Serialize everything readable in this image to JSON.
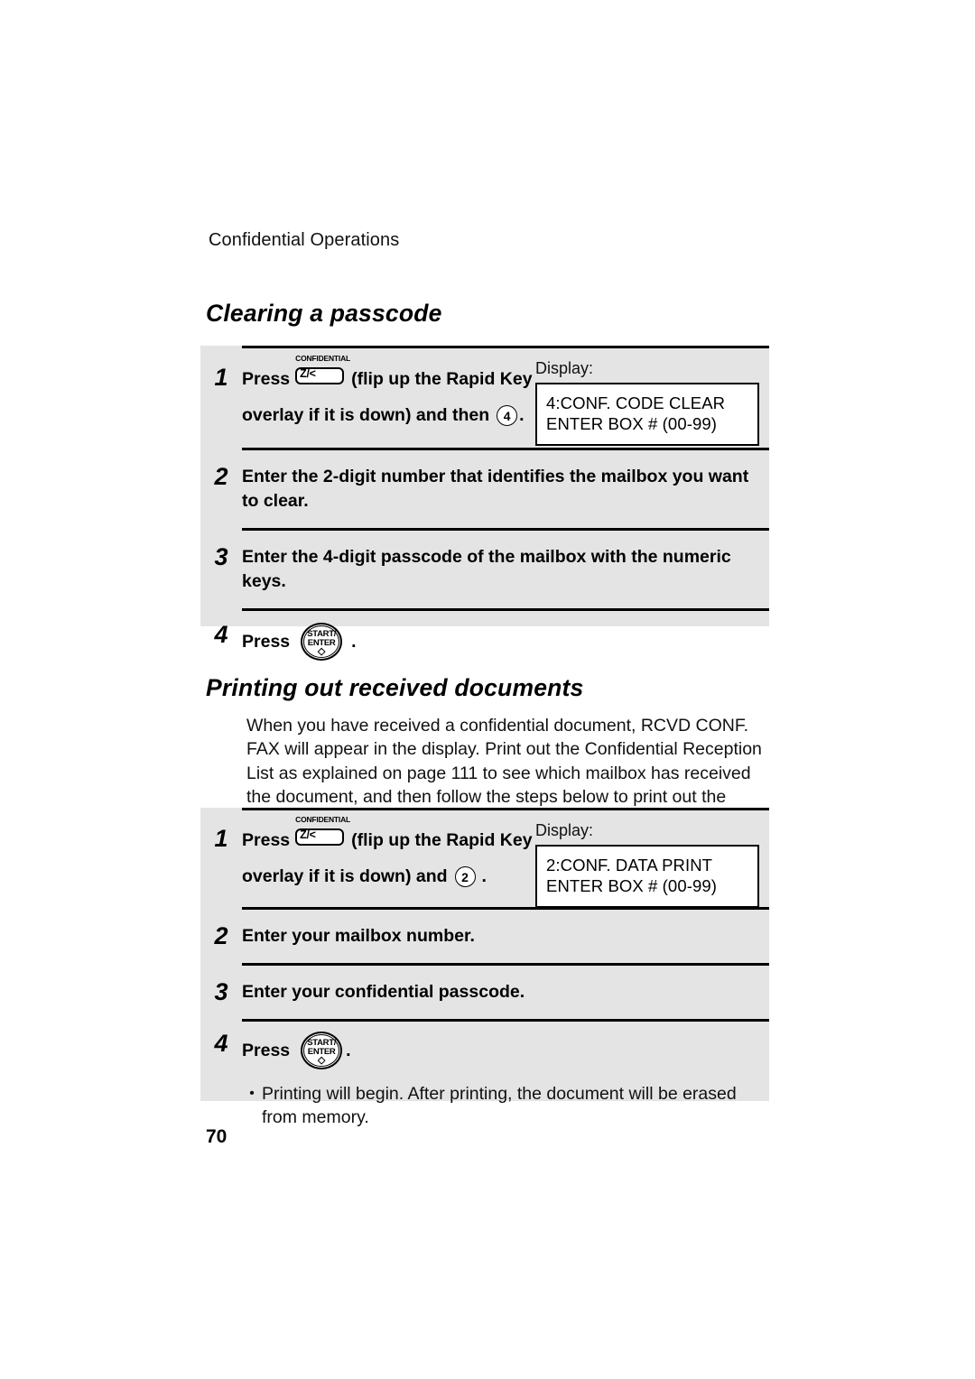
{
  "header": {
    "running_head": "Confidential Operations"
  },
  "sections": [
    {
      "heading": "Clearing a passcode",
      "steps": [
        {
          "number": "1",
          "line1_before": "Press",
          "key_cap": "CONFIDENTIAL",
          "key_face": "Z/<",
          "line1_after": "(flip up the Rapid Key",
          "line2_before": "overlay if it is down) and then",
          "numeric_key": "4",
          "line2_after": ".",
          "display_label": "Display:",
          "display_lines": [
            "4:CONF. CODE CLEAR",
            "ENTER BOX # (00-99)"
          ]
        },
        {
          "number": "2",
          "text": "Enter the 2-digit number that identifies the mailbox you want to clear."
        },
        {
          "number": "3",
          "text": "Enter the 4-digit passcode of the mailbox with the numeric keys."
        },
        {
          "number": "4",
          "press_label": "Press",
          "start_key_line1": "START/",
          "start_key_line2": "ENTER",
          "start_key_glyph": "◇",
          "trailing": "."
        }
      ]
    },
    {
      "heading": "Printing out received documents",
      "intro": "When you have received a confidential document, RCVD CONF. FAX will appear in the display. Print out the Confidential Reception List as explained on page 111 to see which mailbox has received the document, and then follow the steps below to print out the document.",
      "steps": [
        {
          "number": "1",
          "line1_before": "Press",
          "key_cap": "CONFIDENTIAL",
          "key_face": "Z/<",
          "line1_after": "(flip up the Rapid Key",
          "line2_before": "overlay if it is down) and",
          "numeric_key": "2",
          "line2_after": ".",
          "display_label": "Display:",
          "display_lines": [
            "2:CONF. DATA PRINT",
            "ENTER BOX # (00-99)"
          ]
        },
        {
          "number": "2",
          "text": "Enter your mailbox number."
        },
        {
          "number": "3",
          "text": "Enter your confidential passcode."
        },
        {
          "number": "4",
          "press_label": "Press",
          "start_key_line1": "START/",
          "start_key_line2": "ENTER",
          "start_key_glyph": "◇",
          "trailing": "."
        }
      ],
      "note": {
        "bullet": "•",
        "text": "Printing will begin. After printing, the document will be erased from memory."
      }
    }
  ],
  "footer": {
    "page_number": "70"
  }
}
